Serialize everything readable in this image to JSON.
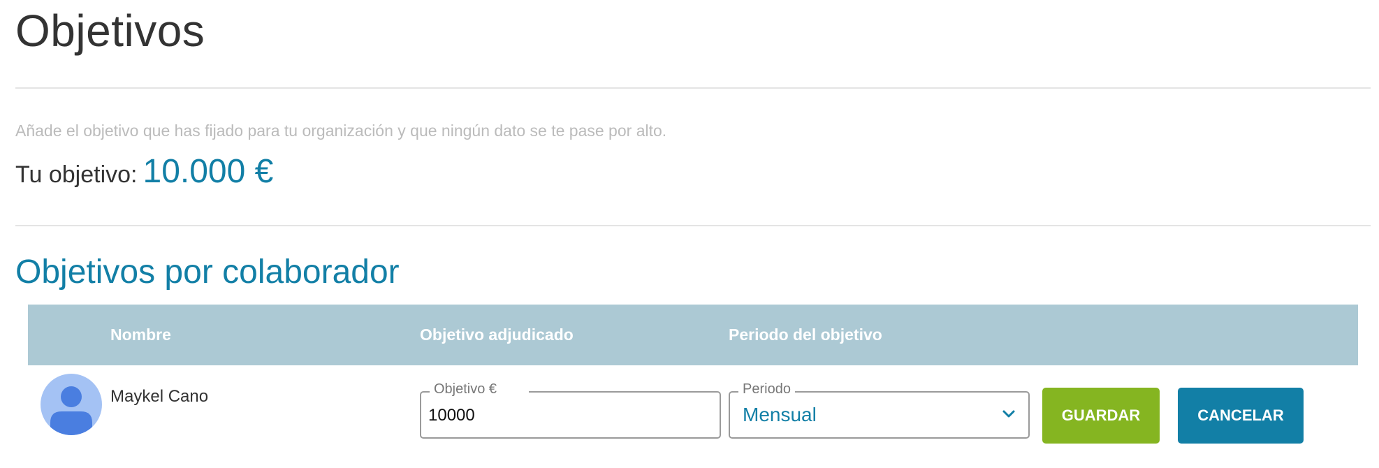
{
  "page": {
    "title": "Objetivos",
    "description": "Añade el objetivo que has fijado para tu organización y que ningún dato se te pase por alto.",
    "goal_label": "Tu objetivo:",
    "goal_value": "10.000 €"
  },
  "section": {
    "title": "Objetivos por colaborador"
  },
  "table": {
    "columns": [
      "Nombre",
      "Objetivo adjudicado",
      "Periodo del objetivo"
    ],
    "rows": [
      {
        "name": "Maykel Cano",
        "goal_field_label": "Objetivo €",
        "goal_value": "10000",
        "period_field_label": "Periodo",
        "period_value": "Mensual",
        "save_label": "GUARDAR",
        "cancel_label": "CANCELAR"
      }
    ]
  },
  "icons": {
    "avatar": "user-avatar-icon",
    "select_arrow": "chevron-down-icon"
  },
  "colors": {
    "accent": "#127fa6",
    "header_bg": "#acc9d4",
    "save": "#85b521",
    "cancel": "#127fa6",
    "avatar_bg": "#a4c2f4",
    "avatar_fg": "#4a7ee0"
  }
}
